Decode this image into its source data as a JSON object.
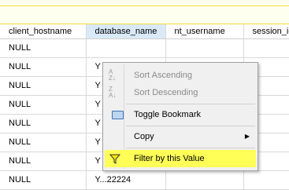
{
  "grid": {
    "columns": [
      "client_hostname",
      "database_name",
      "nt_username",
      "session_id"
    ],
    "rows": [
      {
        "client_hostname": "NULL",
        "database_name": "",
        "nt_username": "",
        "session_id": ""
      },
      {
        "client_hostname": "NULL",
        "database_name": "Y",
        "nt_username": "",
        "session_id": ""
      },
      {
        "client_hostname": "NULL",
        "database_name": "Y",
        "nt_username": "",
        "session_id": ""
      },
      {
        "client_hostname": "NULL",
        "database_name": "Y",
        "nt_username": "",
        "session_id": ""
      },
      {
        "client_hostname": "NULL",
        "database_name": "Y",
        "nt_username": "",
        "session_id": ""
      },
      {
        "client_hostname": "NULL",
        "database_name": "Y",
        "nt_username": "",
        "session_id": ""
      },
      {
        "client_hostname": "NULL",
        "database_name": "Y",
        "nt_username": "",
        "session_id": ""
      },
      {
        "client_hostname": "NULL",
        "database_name": "Y...22224",
        "nt_username": "",
        "session_id": ""
      }
    ]
  },
  "context_menu": {
    "sort_ascending": "Sort Ascending",
    "sort_descending": "Sort Descending",
    "toggle_bookmark": "Toggle Bookmark",
    "copy": "Copy",
    "filter_by_value": "Filter by this Value"
  },
  "colors": {
    "highlight": "#ffff58",
    "selected_header": "#d9e9f8",
    "top_border": "#f2dc38"
  }
}
